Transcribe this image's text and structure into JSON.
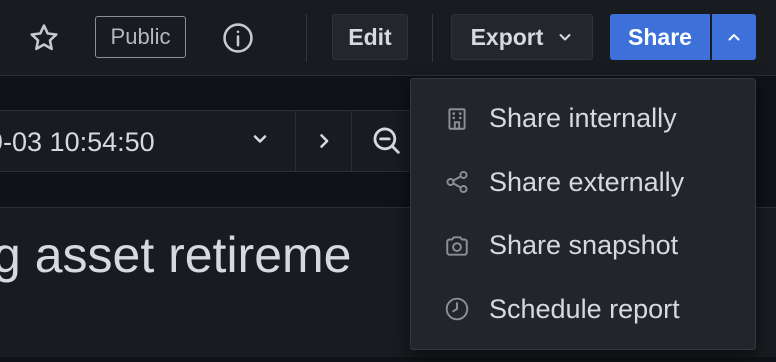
{
  "toolbar": {
    "public_label": "Public",
    "edit_label": "Edit",
    "export_label": "Export",
    "share_label": "Share"
  },
  "time_picker": {
    "range_text": "-09-03 10:54:50"
  },
  "panel": {
    "title": "g asset retireme"
  },
  "share_menu": {
    "items": [
      {
        "label": "Share internally",
        "icon": "building-icon"
      },
      {
        "label": "Share externally",
        "icon": "share-nodes-icon"
      },
      {
        "label": "Share snapshot",
        "icon": "camera-icon"
      },
      {
        "label": "Schedule report",
        "icon": "clock-icon"
      }
    ]
  },
  "colors": {
    "background": "#111217",
    "surface": "#181b1f",
    "menu": "#22252b",
    "primary": "#3d71d9",
    "text": "#d8d9e0"
  }
}
